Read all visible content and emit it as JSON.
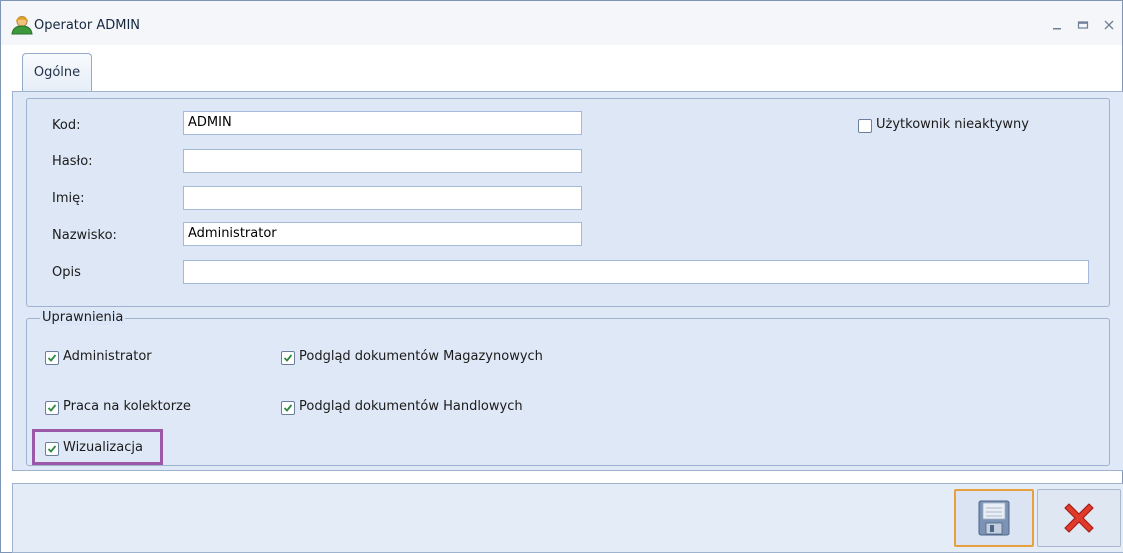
{
  "window": {
    "title": "Operator ADMIN",
    "controls": [
      "minimize-icon",
      "maximize-icon",
      "close-icon"
    ]
  },
  "tabs": [
    {
      "label": "Ogólne",
      "active": true
    }
  ],
  "form": {
    "kod": {
      "label": "Kod:",
      "value": "ADMIN"
    },
    "haslo": {
      "label": "Hasło:",
      "value": ""
    },
    "imie": {
      "label": "Imię:",
      "value": ""
    },
    "nazwisko": {
      "label": "Nazwisko:",
      "value": "Administrator"
    },
    "opis": {
      "label": "Opis",
      "value": ""
    },
    "nieaktywny": {
      "label": "Użytkownik nieaktywny",
      "checked": false
    }
  },
  "permissions": {
    "title": "Uprawnienia",
    "items": [
      {
        "label": "Administrator",
        "checked": true
      },
      {
        "label": "Praca na kolektorze",
        "checked": true
      },
      {
        "label": "Wizualizacja",
        "checked": true
      },
      {
        "label": "Podgląd dokumentów Magazynowych",
        "checked": true
      },
      {
        "label": "Podgląd dokumentów Handlowych",
        "checked": true
      }
    ]
  },
  "buttons": {
    "save": {
      "icon": "floppy-disk-icon"
    },
    "cancel": {
      "icon": "red-x-icon"
    }
  },
  "colors": {
    "highlight": "#9b58a9",
    "save_border": "#e7a03d",
    "cancel_red": "#e03a2a"
  }
}
